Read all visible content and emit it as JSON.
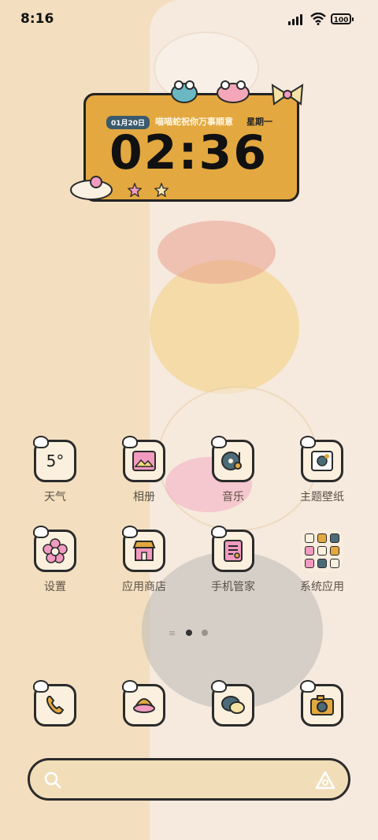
{
  "status_bar": {
    "time": "8:16",
    "battery": "100"
  },
  "clock_widget": {
    "date": "01月20日",
    "greeting": "喵喵蛇祝你万事顺意",
    "weekday": "星期一",
    "time": "02:36"
  },
  "apps_row1": [
    {
      "label": "天气",
      "icon": "weather-icon",
      "temp": "5°"
    },
    {
      "label": "相册",
      "icon": "gallery-icon"
    },
    {
      "label": "音乐",
      "icon": "music-icon"
    },
    {
      "label": "主题壁纸",
      "icon": "theme-icon"
    }
  ],
  "apps_row2": [
    {
      "label": "设置",
      "icon": "settings-flower-icon"
    },
    {
      "label": "应用商店",
      "icon": "store-icon"
    },
    {
      "label": "手机管家",
      "icon": "security-icon"
    },
    {
      "label": "系统应用",
      "icon": "folder-icon"
    }
  ],
  "dock": [
    {
      "icon": "phone-icon"
    },
    {
      "icon": "browser-icon"
    },
    {
      "icon": "messages-icon"
    },
    {
      "icon": "camera-icon"
    }
  ],
  "colors": {
    "accent": "#e3a83f",
    "outline": "#2b2b2b",
    "pink": "#f29ac0"
  }
}
